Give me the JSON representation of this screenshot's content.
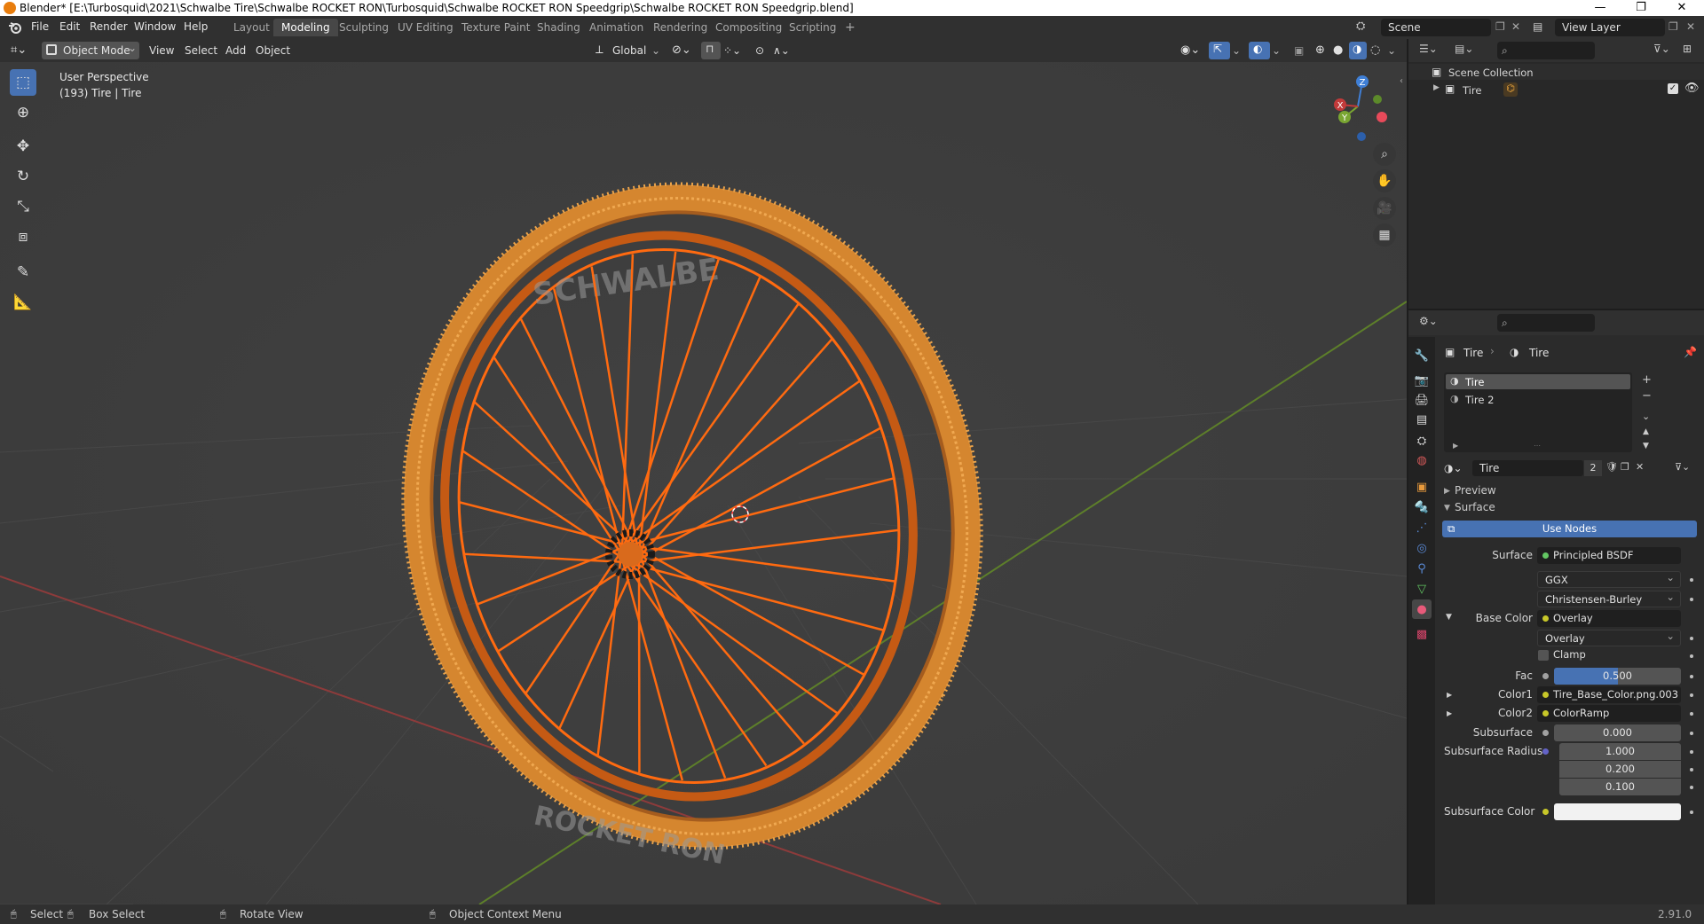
{
  "window": {
    "title": "Blender* [E:\\Turbosquid\\2021\\Schwalbe Tire\\Schwalbe ROCKET RON\\Turbosquid\\Schwalbe ROCKET RON Speedgrip\\Schwalbe ROCKET RON Speedgrip.blend]",
    "minimize": "—",
    "maximize": "❐",
    "close": "✕"
  },
  "menu": {
    "file": "File",
    "edit": "Edit",
    "render": "Render",
    "window": "Window",
    "help": "Help"
  },
  "workspaces": [
    "Layout",
    "Modeling",
    "Sculpting",
    "UV Editing",
    "Texture Paint",
    "Shading",
    "Animation",
    "Rendering",
    "Compositing",
    "Scripting"
  ],
  "workspace_active": "Modeling",
  "workspace_add": "+",
  "scene": {
    "name": "Scene",
    "view_layer": "View Layer"
  },
  "viewport_header": {
    "mode": "Object Mode",
    "view": "View",
    "select": "Select",
    "add": "Add",
    "object": "Object",
    "transform_orientation": "Global"
  },
  "viewport": {
    "perspective": "User Perspective",
    "object_info": "(193) Tire | Tire",
    "gizmo": {
      "x": "X",
      "y": "Y",
      "z": "Z"
    },
    "tire_text_top": "SCHWALBE",
    "tire_text_bottom": "ROCKET RON"
  },
  "outliner": {
    "search_placeholder": "",
    "scene_collection": "Scene Collection",
    "items": [
      {
        "name": "Tire"
      }
    ]
  },
  "properties": {
    "breadcrumb_object": "Tire",
    "breadcrumb_material": "Tire",
    "slots": [
      "Tire",
      "Tire 2"
    ],
    "material_name": "Tire",
    "material_users": "2",
    "panels": {
      "preview": "Preview",
      "surface": "Surface"
    },
    "use_nodes": "Use Nodes",
    "surface_label": "Surface",
    "surface_value": "Principled BSDF",
    "distribution": "GGX",
    "subsurface_method": "Christensen-Burley",
    "base_color_label": "Base Color",
    "base_color_value": "Overlay",
    "blend_mode": "Overlay",
    "clamp_label": "Clamp",
    "fac_label": "Fac",
    "fac_value": "0.500",
    "fac_fraction": 0.5,
    "color1_label": "Color1",
    "color1_value": "Tire_Base_Color.png.003",
    "color2_label": "Color2",
    "color2_value": "ColorRamp",
    "subsurface_label": "Subsurface",
    "subsurface_value": "0.000",
    "subsurface_radius_label": "Subsurface Radius",
    "subsurface_radius": [
      "1.000",
      "0.200",
      "0.100"
    ],
    "subsurface_color_label": "Subsurface Color"
  },
  "statusbar": {
    "select": "Select",
    "box_select": "Box Select",
    "rotate_view": "Rotate View",
    "context_menu": "Object Context Menu",
    "version": "2.91.0"
  },
  "colors": {
    "accent": "#4772b3",
    "wire_orange": "#ff7a1a",
    "tire_orange": "#e89a3c",
    "x_axis": "#a63a3a",
    "y_axis": "#6a9a2a",
    "socket_yellow": "#c7c729",
    "socket_grey": "#a1a1a1",
    "socket_purple": "#6363c7",
    "socket_green": "#63c763"
  }
}
